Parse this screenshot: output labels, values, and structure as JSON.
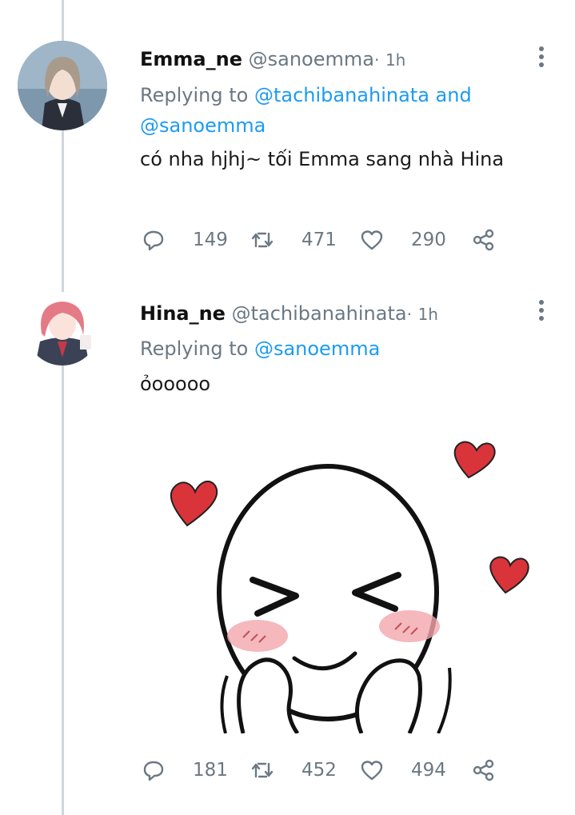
{
  "colors": {
    "mention": "#1d9bf0",
    "muted": "#6b7883",
    "thread_line": "#d0d6dc"
  },
  "tweets": [
    {
      "display_name": "Emma_ne",
      "handle": "@sanoemma",
      "dot": "·",
      "time": "1h",
      "reply_prefix": "Replying to",
      "reply_mentions": "@tachibanahinata and @sanoemma",
      "text": "có nha hjhj~ tối Emma sang nhà Hina",
      "stats": {
        "replies": "149",
        "retweets": "471",
        "likes": "290"
      }
    },
    {
      "display_name": "Hina_ne",
      "handle": "@tachibanahinata",
      "dot": "·",
      "time": "1h",
      "reply_prefix": "Replying to",
      "reply_mentions": "@sanoemma",
      "text": "ỏooooo",
      "has_media": true,
      "stats": {
        "replies": "181",
        "retweets": "452",
        "likes": "494"
      }
    }
  ],
  "icons": [
    "reply-icon",
    "retweet-icon",
    "like-icon",
    "share-icon",
    "more-options-icon"
  ]
}
